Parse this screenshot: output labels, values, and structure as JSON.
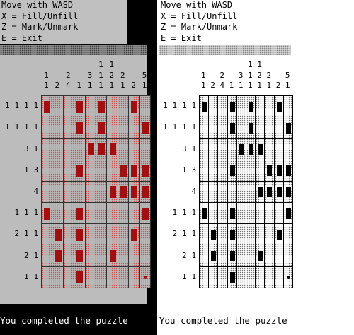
{
  "instructions": {
    "line1": "Move with WASD",
    "line2": "X = Fill/Unfill",
    "line3": "Z = Mark/Unmark",
    "line4": "E = Exit"
  },
  "status": "You completed the puzzle",
  "colors": {
    "fill_left": "#a01010",
    "fill_right": "#000000"
  },
  "puzzle": {
    "columns": 10,
    "rows": 9,
    "column_clues": [
      [
        "1",
        "1"
      ],
      [
        "2"
      ],
      [
        "2",
        "4"
      ],
      [
        "1"
      ],
      [
        "3",
        "1"
      ],
      [
        "1",
        "1",
        "1"
      ],
      [
        "1",
        "2",
        "1"
      ],
      [
        "2",
        "1"
      ],
      [
        "2"
      ],
      [
        "5",
        "1"
      ]
    ],
    "row_clues": [
      [
        "1",
        "1",
        "1",
        "1"
      ],
      [
        "1",
        "1",
        "1",
        "1"
      ],
      [
        "3",
        "1"
      ],
      [
        "1",
        "3"
      ],
      [
        "4"
      ],
      [
        "1",
        "1",
        "1"
      ],
      [
        "2",
        "1",
        "1"
      ],
      [
        "2",
        "1"
      ],
      [
        "1",
        "1"
      ]
    ],
    "grid": [
      [
        1,
        0,
        0,
        1,
        0,
        1,
        0,
        0,
        1,
        0
      ],
      [
        0,
        0,
        0,
        1,
        0,
        1,
        0,
        0,
        0,
        1
      ],
      [
        0,
        0,
        0,
        0,
        1,
        1,
        1,
        0,
        0,
        0
      ],
      [
        0,
        0,
        0,
        1,
        0,
        0,
        0,
        1,
        1,
        1
      ],
      [
        0,
        0,
        0,
        0,
        0,
        0,
        1,
        1,
        1,
        1
      ],
      [
        1,
        0,
        0,
        1,
        0,
        0,
        0,
        0,
        0,
        1
      ],
      [
        0,
        1,
        0,
        1,
        0,
        0,
        0,
        0,
        1,
        0
      ],
      [
        0,
        1,
        0,
        1,
        0,
        0,
        1,
        0,
        0,
        0
      ],
      [
        0,
        0,
        0,
        1,
        0,
        0,
        0,
        0,
        0,
        0
      ]
    ],
    "marks": [
      [
        8,
        9
      ]
    ]
  }
}
